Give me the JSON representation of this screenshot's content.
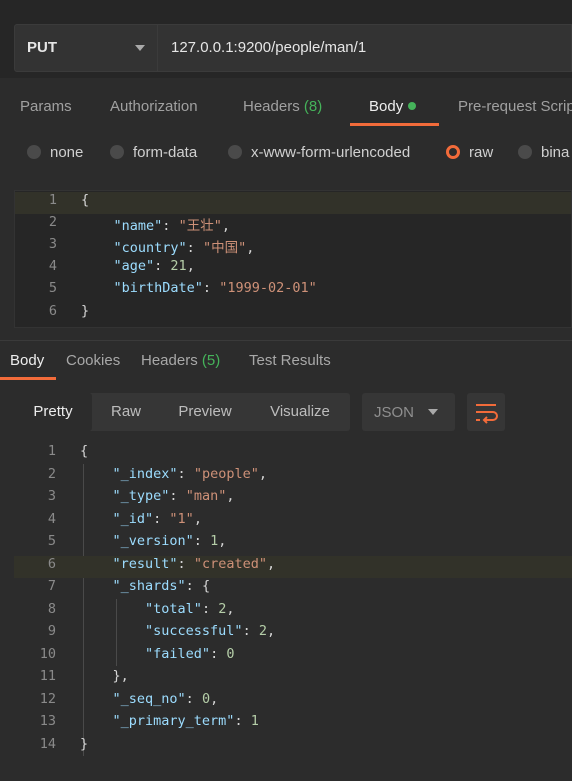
{
  "request": {
    "method": "PUT",
    "url": "127.0.0.1:9200/people/man/1"
  },
  "request_tabs": [
    {
      "label": "Params"
    },
    {
      "label": "Authorization"
    },
    {
      "label": "Headers",
      "count": "(8)"
    },
    {
      "label": "Body"
    },
    {
      "label": "Pre-request Scrip"
    }
  ],
  "body_types": [
    {
      "label": "none"
    },
    {
      "label": "form-data"
    },
    {
      "label": "x-www-form-urlencoded"
    },
    {
      "label": "raw",
      "selected": true
    },
    {
      "label": "bina"
    }
  ],
  "request_body": {
    "line_numbers": [
      "1",
      "2",
      "3",
      "4",
      "5",
      "6"
    ],
    "lines": [
      {
        "open": "{"
      },
      {
        "key": "\"name\"",
        "value": "\"王壮\""
      },
      {
        "key": "\"country\"",
        "value": "\"中国\""
      },
      {
        "key": "\"age\"",
        "value": "21"
      },
      {
        "key": "\"birthDate\"",
        "value": "\"1999-02-01\""
      },
      {
        "close": "}"
      }
    ]
  },
  "response_tabs": [
    {
      "label": "Body"
    },
    {
      "label": "Cookies"
    },
    {
      "label": "Headers",
      "count": "(5)"
    },
    {
      "label": "Test Results"
    }
  ],
  "view_modes": [
    "Pretty",
    "Raw",
    "Preview",
    "Visualize"
  ],
  "active_view": "Pretty",
  "format": "JSON",
  "response_body": {
    "line_numbers": [
      "1",
      "2",
      "3",
      "4",
      "5",
      "6",
      "7",
      "8",
      "9",
      "10",
      "11",
      "12",
      "13",
      "14"
    ],
    "lines": [
      {
        "open": "{"
      },
      {
        "key": "\"_index\"",
        "value": "\"people\""
      },
      {
        "key": "\"_type\"",
        "value": "\"man\""
      },
      {
        "key": "\"_id\"",
        "value": "\"1\""
      },
      {
        "key": "\"_version\"",
        "value": "1"
      },
      {
        "key": "\"result\"",
        "value": "\"created\""
      },
      {
        "key": "\"_shards\"",
        "value": "{"
      },
      {
        "key": "\"total\"",
        "value": "2"
      },
      {
        "key": "\"successful\"",
        "value": "2"
      },
      {
        "key": "\"failed\"",
        "value": "0"
      },
      {
        "close": "},"
      },
      {
        "key": "\"_seq_no\"",
        "value": "0"
      },
      {
        "key": "\"_primary_term\"",
        "value": "1"
      },
      {
        "close": "}"
      }
    ]
  },
  "colors": {
    "accent": "#f26b3a",
    "count_green": "#45b35a",
    "json_key": "#9cdcfe",
    "json_string": "#ce9178",
    "json_number": "#b5cea8"
  },
  "icons": {
    "method_dropdown": "chevron-down-icon",
    "format_dropdown": "chevron-down-icon",
    "wrap": "wrap-lines-icon"
  }
}
